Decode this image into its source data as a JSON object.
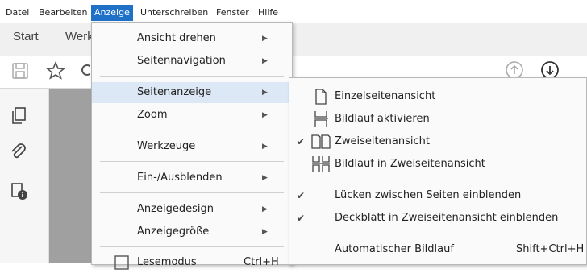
{
  "menubar": {
    "items": [
      "Datei",
      "Bearbeiten",
      "Anzeige",
      "Unterschreiben",
      "Fenster",
      "Hilfe"
    ],
    "active": "Anzeige"
  },
  "tabs": [
    "Start",
    "Werk"
  ],
  "anzeige_menu": {
    "items": [
      {
        "label": "Ansicht drehen",
        "submenu": true
      },
      {
        "label": "Seitennavigation",
        "submenu": true
      },
      {
        "label": "Seitenanzeige",
        "submenu": true,
        "highlighted": true
      },
      {
        "label": "Zoom",
        "submenu": true
      },
      {
        "label": "Werkzeuge",
        "submenu": true
      },
      {
        "label": "Ein-/Ausblenden",
        "submenu": true
      },
      {
        "label": "Anzeigedesign",
        "submenu": true
      },
      {
        "label": "Anzeigegröße",
        "submenu": true
      },
      {
        "label": "Lesemodus",
        "shortcut": "Ctrl+H"
      }
    ]
  },
  "seitenanzeige_menu": {
    "items": [
      {
        "label": "Einzelseitenansicht",
        "icon": "single-page-icon",
        "checked": false
      },
      {
        "label": "Bildlauf aktivieren",
        "icon": "scroll-icon",
        "checked": false
      },
      {
        "label": "Zweiseitenansicht",
        "icon": "two-page-icon",
        "checked": true
      },
      {
        "label": "Bildlauf in Zweiseitenansicht",
        "icon": "two-page-scroll-icon",
        "checked": false
      },
      {
        "label": "Lücken zwischen Seiten einblenden",
        "checked": true
      },
      {
        "label": "Deckblatt in Zweiseitenansicht einblenden",
        "checked": true
      },
      {
        "label": "Automatischer Bildlauf",
        "shortcut": "Shift+Ctrl+H"
      }
    ]
  },
  "colors": {
    "menu_active": "#1f71c8",
    "menu_highlight": "#dce8f5",
    "doc_background": "#a0a0a0"
  }
}
